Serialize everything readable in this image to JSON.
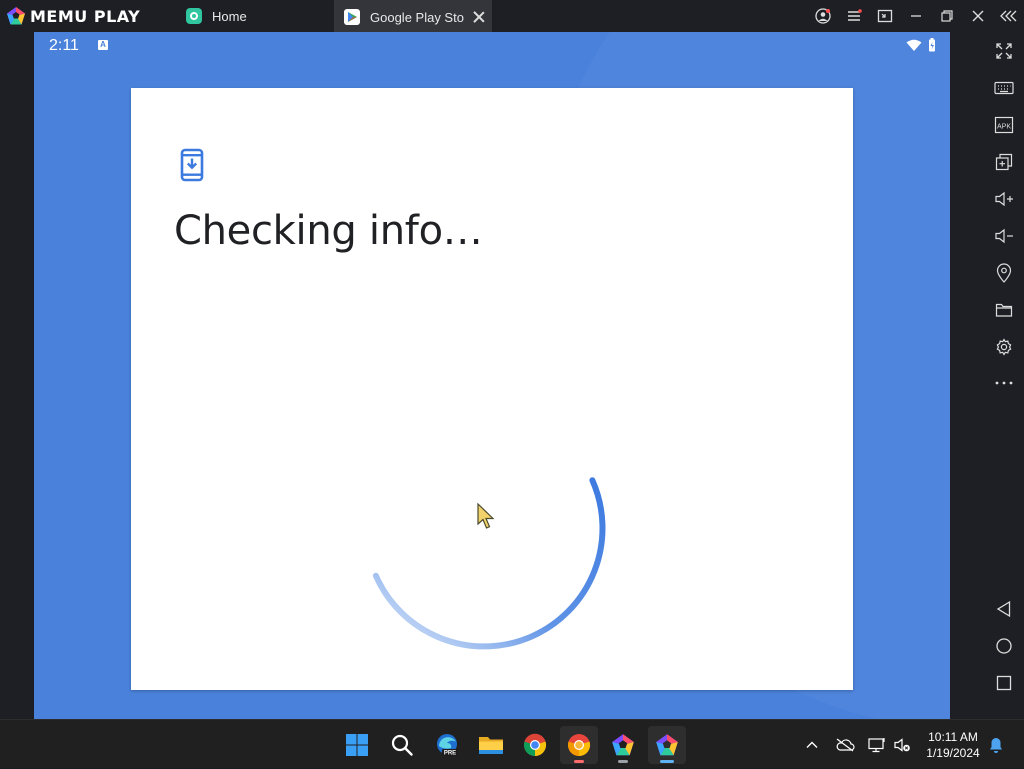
{
  "window": {
    "brand": "MEMU PLAY",
    "tabs": [
      {
        "label": "Home",
        "icon": "memu-home-icon"
      },
      {
        "label": "Google Play Store",
        "icon": "play-store-icon"
      }
    ]
  },
  "android": {
    "status_bar": {
      "time": "2:11",
      "notification_icon": "A"
    },
    "dialog": {
      "icon": "phone-download-icon",
      "title": "Checking info…"
    }
  },
  "sidebar": {
    "items": [
      "fullscreen-icon",
      "keyboard-icon",
      "apk-icon",
      "multi-instance-icon",
      "volume-up-icon",
      "volume-down-icon",
      "location-icon",
      "folder-icon",
      "settings-icon",
      "more-icon",
      "back-icon",
      "home-icon",
      "recents-icon"
    ],
    "apk_label": "APK"
  },
  "taskbar": {
    "apps": [
      "start-icon",
      "search-icon",
      "edge-beta-icon",
      "file-explorer-icon",
      "chrome-icon",
      "chrome-canary-icon",
      "memu-multi-icon",
      "memu-play-icon"
    ],
    "edge_badge": "PRE",
    "time": "10:11 AM",
    "date": "1/19/2024"
  },
  "colors": {
    "android_bg": "#4a82db",
    "spinner": "#3d7ae0",
    "accent": "#4285f4"
  }
}
